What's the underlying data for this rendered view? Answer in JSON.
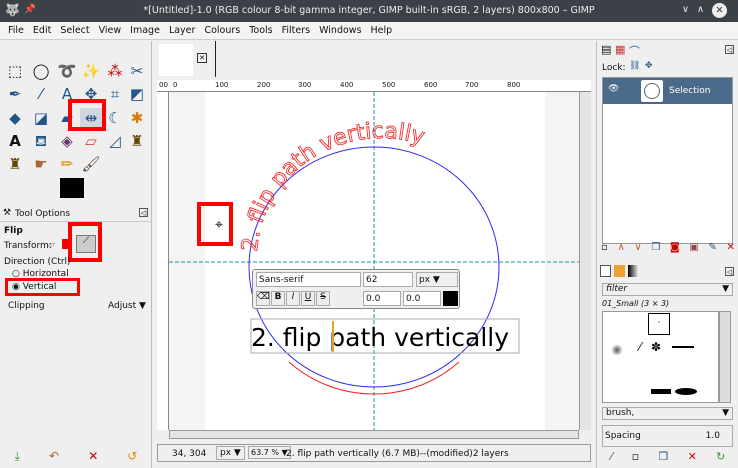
{
  "window": {
    "title": "*[Untitled]-1.0 (RGB colour 8-bit gamma integer, GIMP built-in sRGB, 2 layers) 800x800 – GIMP"
  },
  "menu": [
    "File",
    "Edit",
    "Select",
    "View",
    "Image",
    "Layer",
    "Colours",
    "Tools",
    "Filters",
    "Windows",
    "Help"
  ],
  "tool_options": {
    "tab": "Tool Options",
    "tool": "Flip",
    "transform_label": "Transform:",
    "direction_label": "Direction  (Ctrl)",
    "horizontal": "Horizontal",
    "vertical": "Vertical",
    "selected_direction": "Vertical",
    "clipping_label": "Clipping",
    "clipping_value": "Adjust"
  },
  "ruler": {
    "ticks": [
      "00",
      "0",
      "100",
      "200",
      "300",
      "400",
      "500",
      "600",
      "700",
      "800"
    ]
  },
  "canvas": {
    "curved_text": "2. flip path vertically",
    "layer_text": "2. flip path vertically",
    "colors": {
      "path_circle": "#2a2af0",
      "curved_text": "#f03030",
      "guide": "#1a8fb0"
    }
  },
  "text_toolbar": {
    "font": "Sans-serif",
    "size": "62",
    "unit": "px",
    "baseline": "0.0",
    "kerning": "0.0",
    "bold": "B",
    "italic": "I",
    "underline": "U",
    "strike": "S"
  },
  "status": {
    "coords": "34, 304",
    "unit": "px",
    "zoom": "63.7 %",
    "message": "2. flip path vertically (6.7 MB)--(modified)2 layers"
  },
  "layers": {
    "lock_label": "Lock:",
    "items": [
      {
        "name": "Selection"
      }
    ]
  },
  "brushes": {
    "filter_placeholder": "filter",
    "current": "01_Small (3 × 3)",
    "tag": "brush,",
    "spacing_label": "Spacing",
    "spacing_value": "1.0"
  }
}
